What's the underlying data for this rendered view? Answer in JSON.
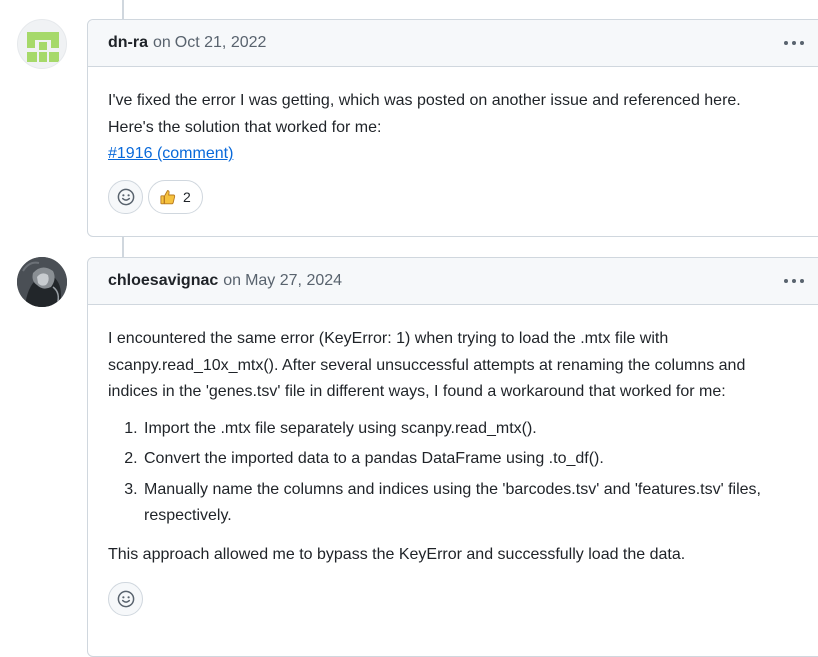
{
  "comments": [
    {
      "author": "dn-ra",
      "on": "on",
      "date": "Oct 21, 2022",
      "body": {
        "line1": "I've fixed the error I was getting, which was posted on another issue and referenced here.",
        "line2": "Here's the solution that worked for me:",
        "link": "#1916 (comment)"
      },
      "reactions": {
        "thumbs_up_count": "2"
      },
      "avatar_color": "#a6d96a"
    },
    {
      "author": "chloesavignac",
      "on": "on",
      "date": "May 27, 2024",
      "body": {
        "intro": "I encountered the same error (KeyError: 1) when trying to load the .mtx file with scanpy.read_10x_mtx(). After several unsuccessful attempts at renaming the columns and indices in the 'genes.tsv' file in different ways, I found a workaround that worked for me:",
        "steps": [
          "Import the .mtx file separately using scanpy.read_mtx().",
          "Convert the imported data to a pandas DataFrame using .to_df().",
          "Manually name the columns and indices using the 'barcodes.tsv' and 'features.tsv' files, respectively."
        ],
        "outro": "This approach allowed me to bypass the KeyError and successfully load the data."
      }
    }
  ],
  "icons": {
    "more": "kebab-horizontal-icon",
    "add_reaction": "smiley-icon",
    "thumbs_up": "thumbs-up-icon"
  },
  "colors": {
    "link": "#0969da",
    "muted": "#59636e",
    "border": "#d0d7de",
    "header_bg": "#f6f8fa"
  }
}
